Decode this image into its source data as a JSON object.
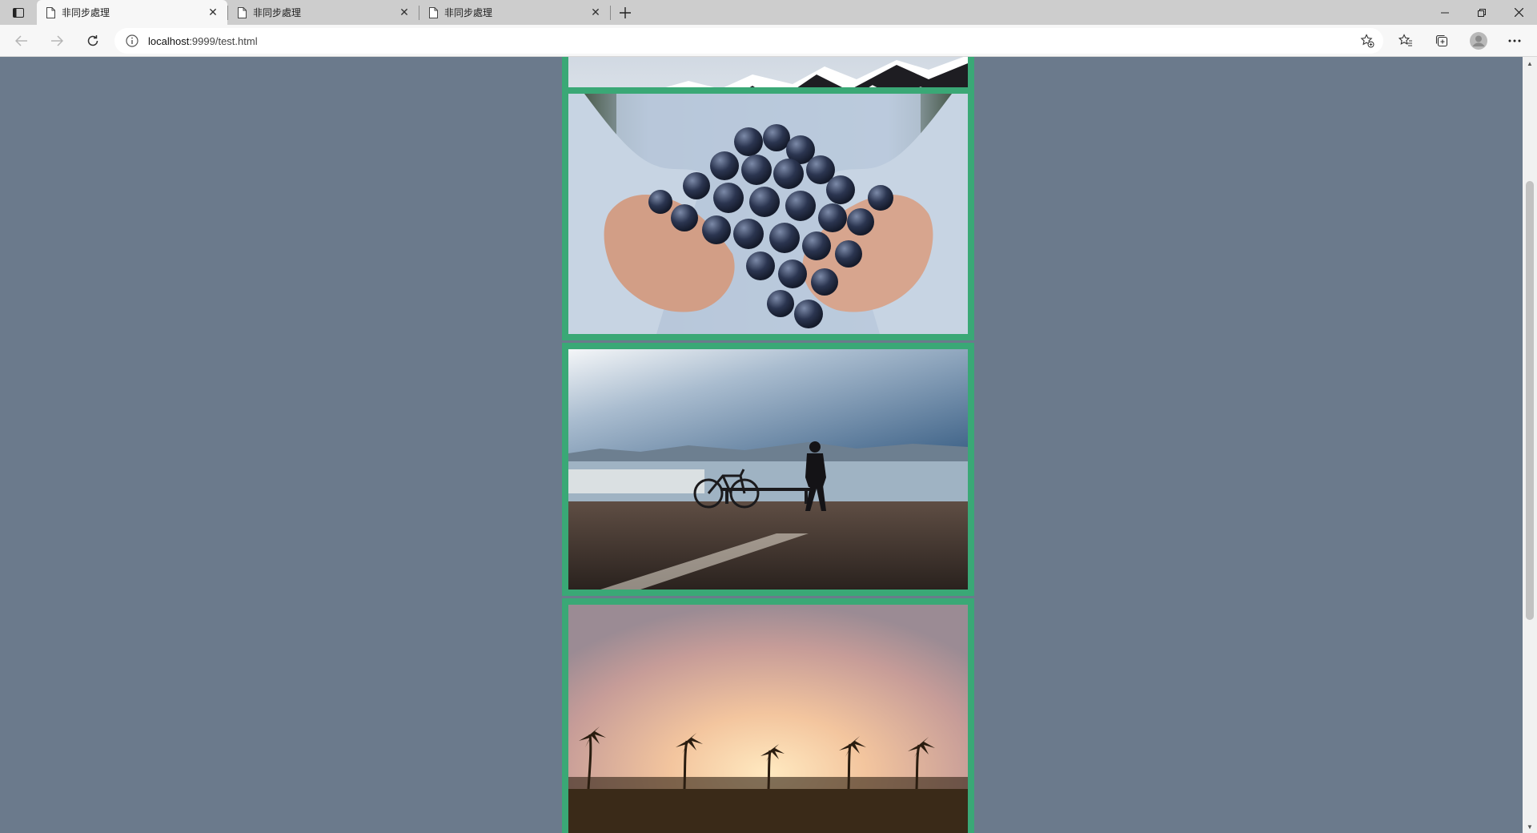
{
  "tabs": [
    {
      "title": "非同步處理",
      "active": true
    },
    {
      "title": "非同步處理",
      "active": false
    },
    {
      "title": "非同步處理",
      "active": false
    }
  ],
  "address": {
    "host": "localhost",
    "rest": ":9999/test.html"
  },
  "icons": {
    "tab_actions": "tab-actions-icon",
    "page": "page-icon",
    "close": "close-icon",
    "new_tab": "plus-icon",
    "back": "back-arrow-icon",
    "forward": "forward-arrow-icon",
    "reload": "reload-icon",
    "info": "info-icon",
    "add_favorite": "star-plus-icon",
    "favorites": "favorites-icon",
    "collections": "collections-icon",
    "profile": "avatar-icon",
    "menu": "more-icon"
  },
  "colors": {
    "frame_border": "#3aa876",
    "page_background": "#6b7a8c"
  },
  "gallery": [
    {
      "subject": "snowy mountain ridge"
    },
    {
      "subject": "hands holding dark grapes"
    },
    {
      "subject": "person with bicycle by the sea"
    },
    {
      "subject": "palm trees at sunset"
    }
  ]
}
